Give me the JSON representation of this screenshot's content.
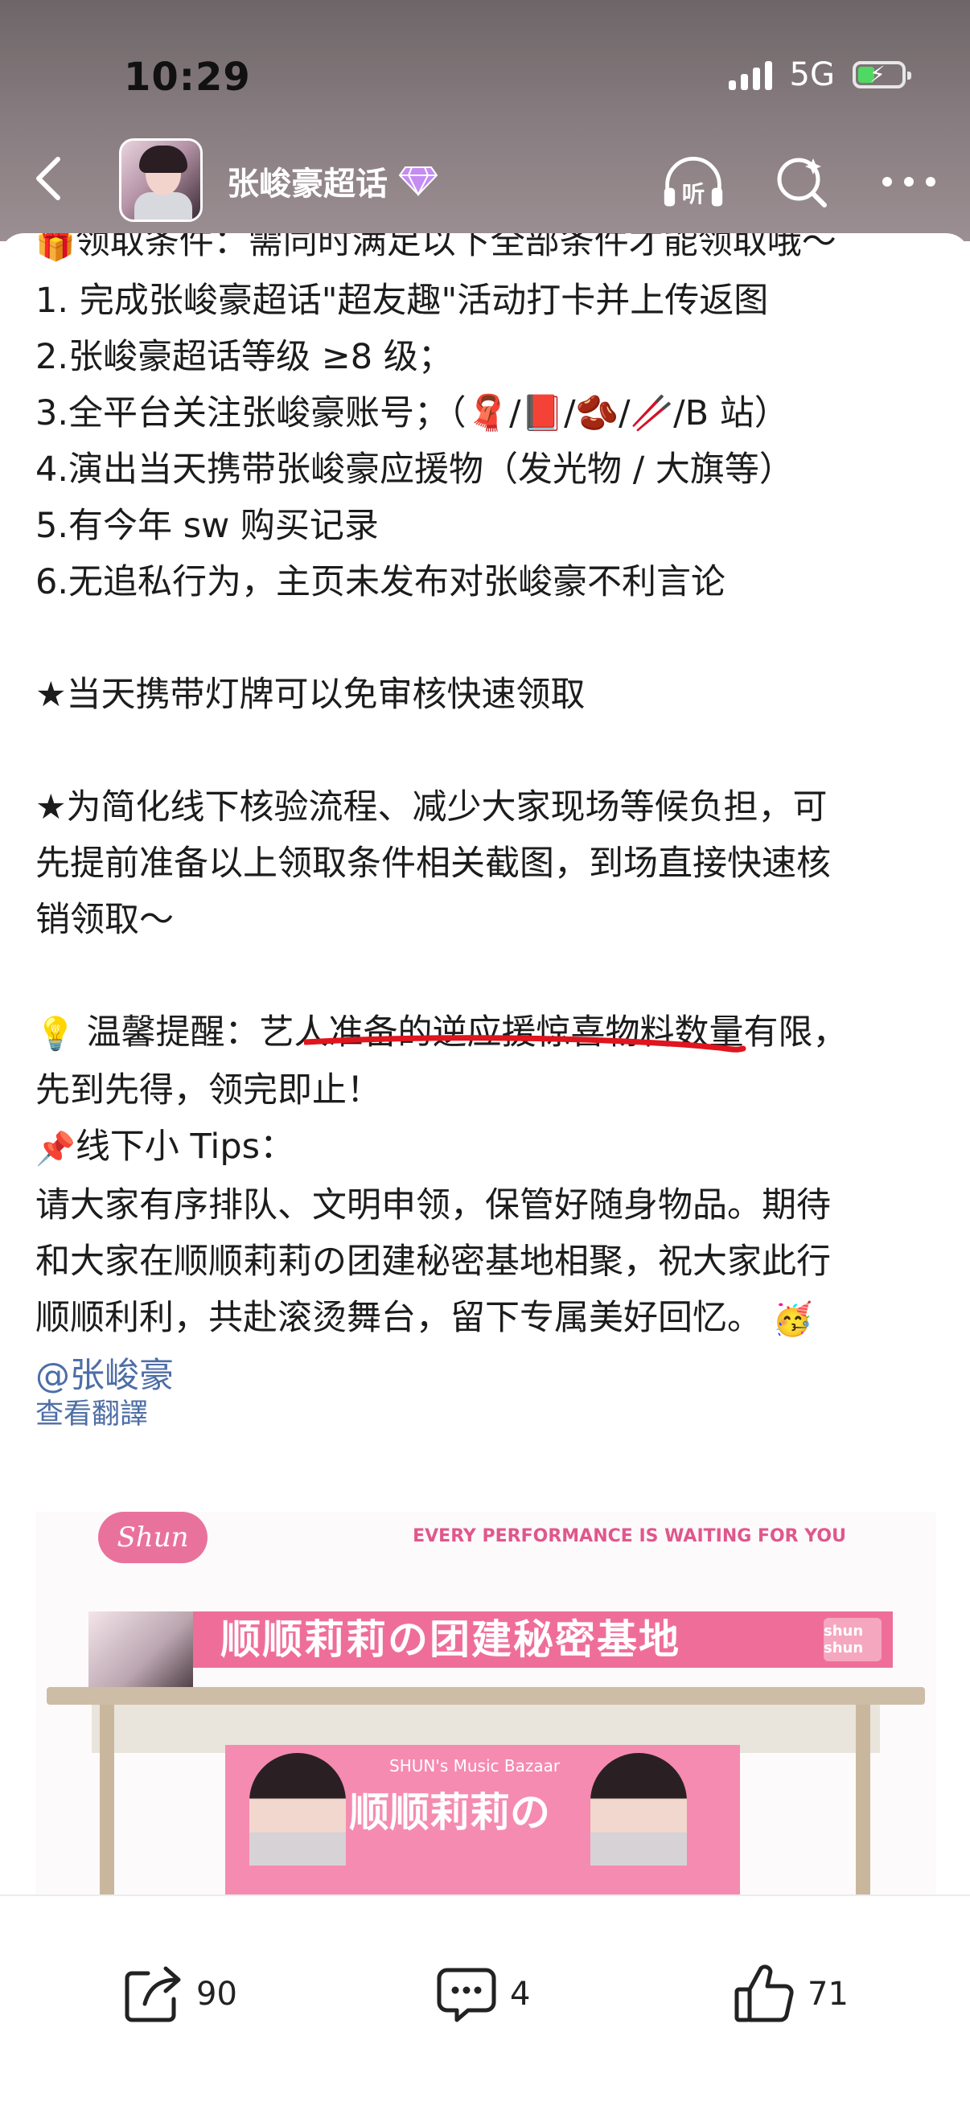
{
  "status_bar": {
    "time": "10:29",
    "network": "5G"
  },
  "nav": {
    "title": "张峻豪超话",
    "listen_icon_label": "听"
  },
  "post": {
    "lines": [
      {
        "icon": "🎁",
        "text": "领取条件：需同时满足以下全部条件才能领取哦～"
      },
      {
        "text": "1. 完成张峻豪超话\"超友趣\"活动打卡并上传返图"
      },
      {
        "text": "2.张峻豪超话等级 ≥8 级；"
      },
      {
        "text": "3.全平台关注张峻豪账号；（🧣/📕/🫘/🥢/B 站）"
      },
      {
        "text": "4.演出当天携带张峻豪应援物（发光物 / 大旗等）"
      },
      {
        "text": "5.有今年 sw 购买记录"
      },
      {
        "text": "6.无追私行为，主页未发布对张峻豪不利言论"
      },
      {
        "text": "★当天携带灯牌可以免审核快速领取"
      },
      {
        "text": "★为简化线下核验流程、减少大家现场等候负担，可"
      },
      {
        "text": "先提前准备以上领取条件相关截图，到场直接快速核"
      },
      {
        "text": "销领取～"
      },
      {
        "icon": "💡",
        "text": "温馨提醒：艺人准备的逆应援惊喜物料数量有限，"
      },
      {
        "text": "先到先得，领完即止！"
      },
      {
        "icon": "📌",
        "text": "线下小 Tips："
      },
      {
        "text": "请大家有序排队、文明申领，保管好随身物品。期待"
      },
      {
        "text": "和大家在顺顺莉莉の团建秘密基地相聚，祝大家此行"
      },
      {
        "text": "顺顺利利，共赴滚烫舞台，留下专属美好回忆。",
        "trail_icon": "🥳"
      }
    ],
    "mention": "@张峻豪",
    "translate_label": "查看翻譯"
  },
  "poster": {
    "logo": "Shun",
    "tagline": "EVERY PERFORMANCE IS WAITING FOR YOU",
    "banner": "顺顺莉莉の团建秘密基地",
    "badge": "shun shun",
    "board_subtitle": "SHUN's Music Bazaar",
    "board_title": "顺顺莉莉の"
  },
  "actions": {
    "share_count": "90",
    "comment_count": "4",
    "like_count": "71"
  },
  "colors": {
    "accent_pink": "#ef6e99",
    "link_blue": "#4e6ea6",
    "underline_red": "#e0151f"
  }
}
